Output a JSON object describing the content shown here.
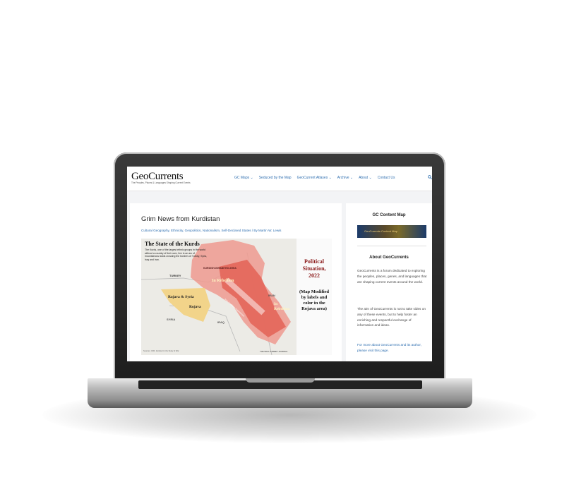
{
  "site": {
    "logo": "GeoCurrents",
    "tagline": "The Peoples, Places & Languages Shaping Current Events"
  },
  "nav": {
    "items": [
      "GC Maps ⌄",
      "Seduced by the Map",
      "GeoCurrent Atlases ⌄",
      "Archive ⌄",
      "About ⌄",
      "Contact Us"
    ]
  },
  "article": {
    "title": "Grim News from Kurdistan",
    "meta": "Cultural Geography, Ethnicity, Geopolitics, Nationalism, Self-Declared States / By Martin W. Lewis"
  },
  "map": {
    "heading": "The State of the Kurds",
    "intro": "The Kurds, one of the largest ethnic groups in the world without a country of their own, live in an arc of mountainous lands crossing the borders of Turkey, Syria, Iraq and Iran.",
    "labels": {
      "turkey": "TURKEY",
      "kurdish_area": "KURDISH-INHABITED AREA",
      "in_rebellion_1": "In Rebellion",
      "in_rebellion_2": "In Rebellion",
      "rojava_syria": "Rojava & Syria",
      "rojava": "Rojava",
      "syria": "SYRIA",
      "iraq": "IRAQ",
      "iran": "IRAN",
      "corridor": "Iraqi Kurdistan Autonomous"
    },
    "side_title": "Political Situation, 2022",
    "side_note": "(Map Modified by labels and color in the Rojava area)",
    "source": "Sources: CFR, Institute for the Study of War",
    "credit": "THE WALL STREET JOURNAL"
  },
  "sidebar": {
    "content_map_title": "GC Content Map",
    "banner_text": "GeoCurrents Content Map",
    "about_title": "About GeoCurrents",
    "about_p1": "GeoCurrents is a forum dedicated to exploring the peoples, places, genes, and languages that are shaping current events around the world.",
    "about_p2": "The aim of GeoCurrents is not to take sides on any of these events, but to help foster an enriching and respectful exchange of information and ideas.",
    "about_link": "For more about GeoCurrents and its author, please visit this page."
  },
  "colors": {
    "link": "#2f6fb0",
    "rebellion": "#e3665a",
    "rojava": "#f2d48a",
    "accent_red": "#8b1a1a"
  }
}
